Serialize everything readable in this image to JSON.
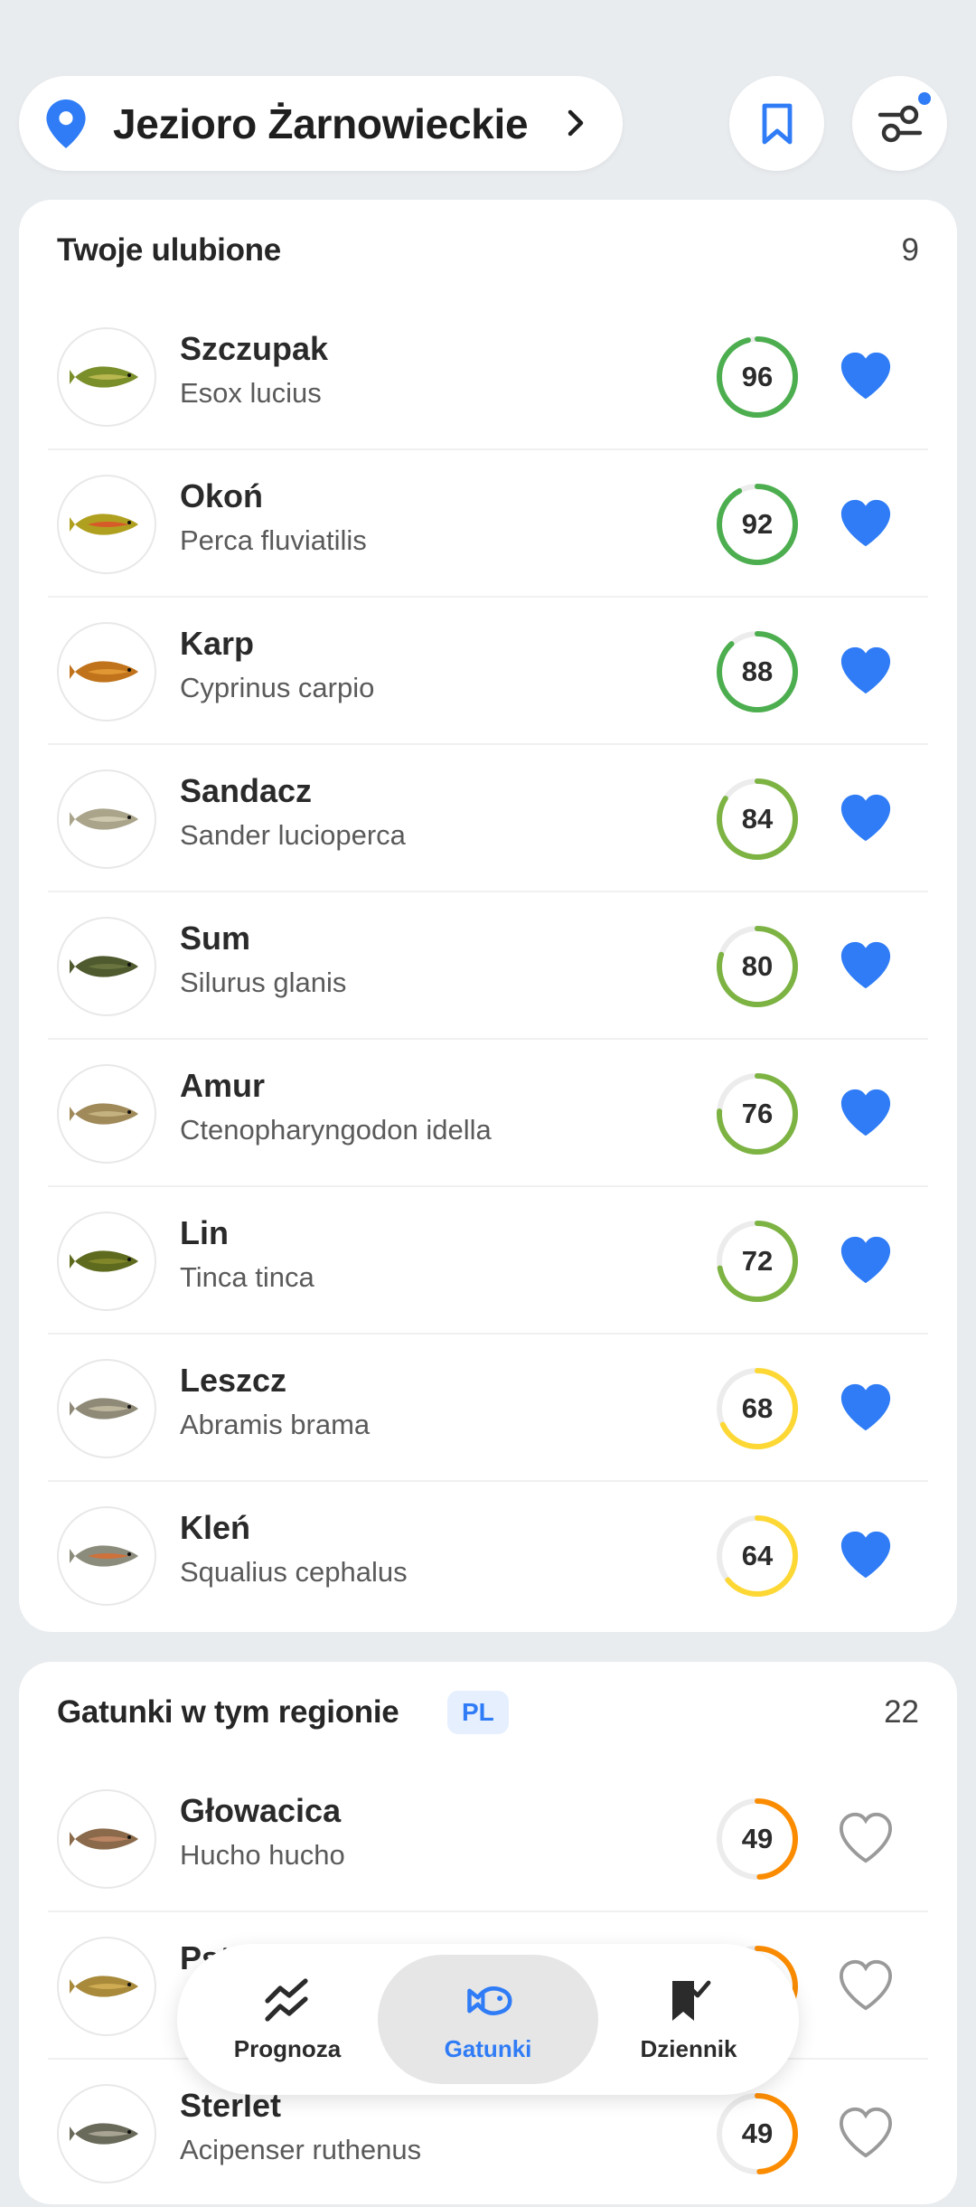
{
  "location": {
    "name": "Jezioro Żarnowieckie"
  },
  "colors": {
    "accent": "#2f7cf6",
    "green": "#4cae4f",
    "lightgreen": "#7cb342",
    "yellow": "#fdd835",
    "orange": "#fb8c00"
  },
  "favorites": {
    "title": "Twoje ulubione",
    "count": "9",
    "items": [
      {
        "name": "Szczupak",
        "latin": "Esox lucius",
        "score": 96,
        "color": "#4cae4f",
        "fav": true
      },
      {
        "name": "Okoń",
        "latin": "Perca fluviatilis",
        "score": 92,
        "color": "#4cae4f",
        "fav": true
      },
      {
        "name": "Karp",
        "latin": "Cyprinus carpio",
        "score": 88,
        "color": "#4cae4f",
        "fav": true
      },
      {
        "name": "Sandacz",
        "latin": "Sander lucioperca",
        "score": 84,
        "color": "#7cb342",
        "fav": true
      },
      {
        "name": "Sum",
        "latin": "Silurus glanis",
        "score": 80,
        "color": "#7cb342",
        "fav": true
      },
      {
        "name": "Amur",
        "latin": "Ctenopharyngodon idella",
        "score": 76,
        "color": "#7cb342",
        "fav": true
      },
      {
        "name": "Lin",
        "latin": "Tinca tinca",
        "score": 72,
        "color": "#7cb342",
        "fav": true
      },
      {
        "name": "Leszcz",
        "latin": "Abramis brama",
        "score": 68,
        "color": "#fdd835",
        "fav": true
      },
      {
        "name": "Kleń",
        "latin": "Squalius cephalus",
        "score": 64,
        "color": "#fdd835",
        "fav": true
      }
    ]
  },
  "region": {
    "title": "Gatunki w tym regionie",
    "badge": "PL",
    "count": "22",
    "items": [
      {
        "name": "Głowacica",
        "latin": "Hucho hucho",
        "score": 49,
        "color": "#fb8c00",
        "fav": false
      },
      {
        "name": "Pst",
        "latin": "",
        "score": 49,
        "color": "#fb8c00",
        "fav": false
      },
      {
        "name": "Sterlet",
        "latin": "Acipenser ruthenus",
        "score": 49,
        "color": "#fb8c00",
        "fav": false
      }
    ]
  },
  "nav": {
    "items": [
      {
        "label": "Prognoza",
        "icon": "forecast-chart-icon",
        "active": false
      },
      {
        "label": "Gatunki",
        "icon": "fish-icon",
        "active": true
      },
      {
        "label": "Dziennik",
        "icon": "journal-flag-icon",
        "active": false
      }
    ]
  }
}
